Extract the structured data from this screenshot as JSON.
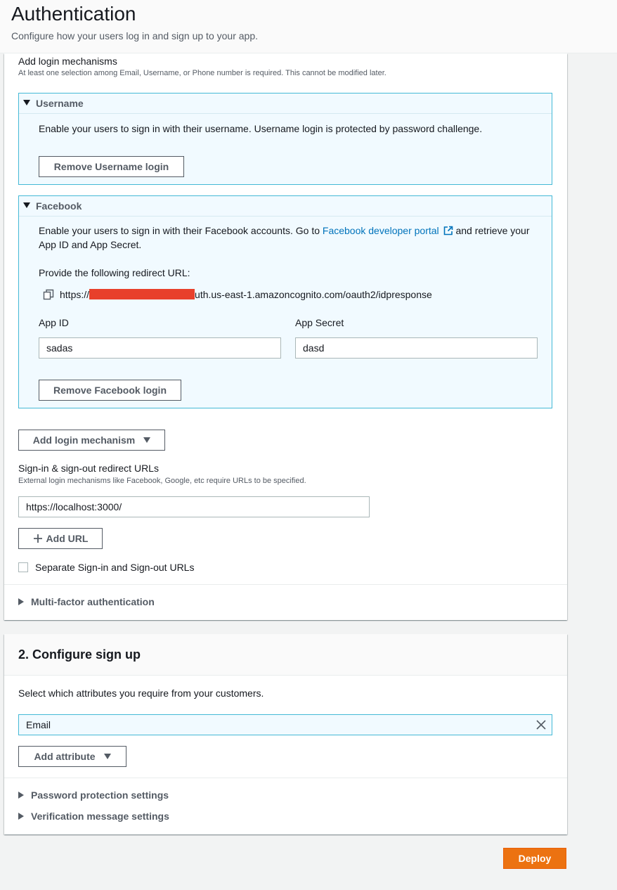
{
  "header": {
    "title": "Authentication",
    "subtitle": "Configure how your users log in and sign up to your app."
  },
  "login": {
    "section_label": "Add login mechanisms",
    "section_desc": "At least one selection among Email, Username, or Phone number is required. This cannot be modified later.",
    "username": {
      "title": "Username",
      "description": "Enable your users to sign in with their username. Username login is protected by password challenge.",
      "remove_label": "Remove Username login"
    },
    "facebook": {
      "title": "Facebook",
      "desc_part1": "Enable your users to sign in with their Facebook accounts. Go to ",
      "link_text": "Facebook developer portal",
      "desc_part2": " and retrieve your",
      "desc_line2": "App ID and App Secret.",
      "redirect_label": "Provide the following redirect URL:",
      "redirect_url_prefix": "https://",
      "redirect_url_suffix": "uth.us-east-1.amazoncognito.com/oauth2/idpresponse",
      "app_id_label": "App ID",
      "app_id_value": "sadas",
      "app_secret_label": "App Secret",
      "app_secret_value": "dasd",
      "remove_label": "Remove Facebook login"
    },
    "add_mechanism_label": "Add login mechanism",
    "redirect_urls_label": "Sign-in & sign-out redirect URLs",
    "redirect_urls_desc": "External login mechanisms like Facebook, Google, etc require URLs to be specified.",
    "redirect_url_value": "https://localhost:3000/",
    "add_url_label": "Add URL",
    "separate_label": "Separate Sign-in and Sign-out URLs",
    "mfa_label": "Multi-factor authentication"
  },
  "signup": {
    "title": "2. Configure sign up",
    "desc": "Select which attributes you require from your customers.",
    "attribute_value": "Email",
    "add_attribute_label": "Add attribute",
    "password_settings_label": "Password protection settings",
    "verification_label": "Verification message settings"
  },
  "deploy_label": "Deploy",
  "colors": {
    "accent": "#0073bb",
    "deploy": "#ec7211",
    "expanded_border": "#44b9d6",
    "expanded_bg": "#f1faff",
    "redaction": "#e8402b"
  }
}
